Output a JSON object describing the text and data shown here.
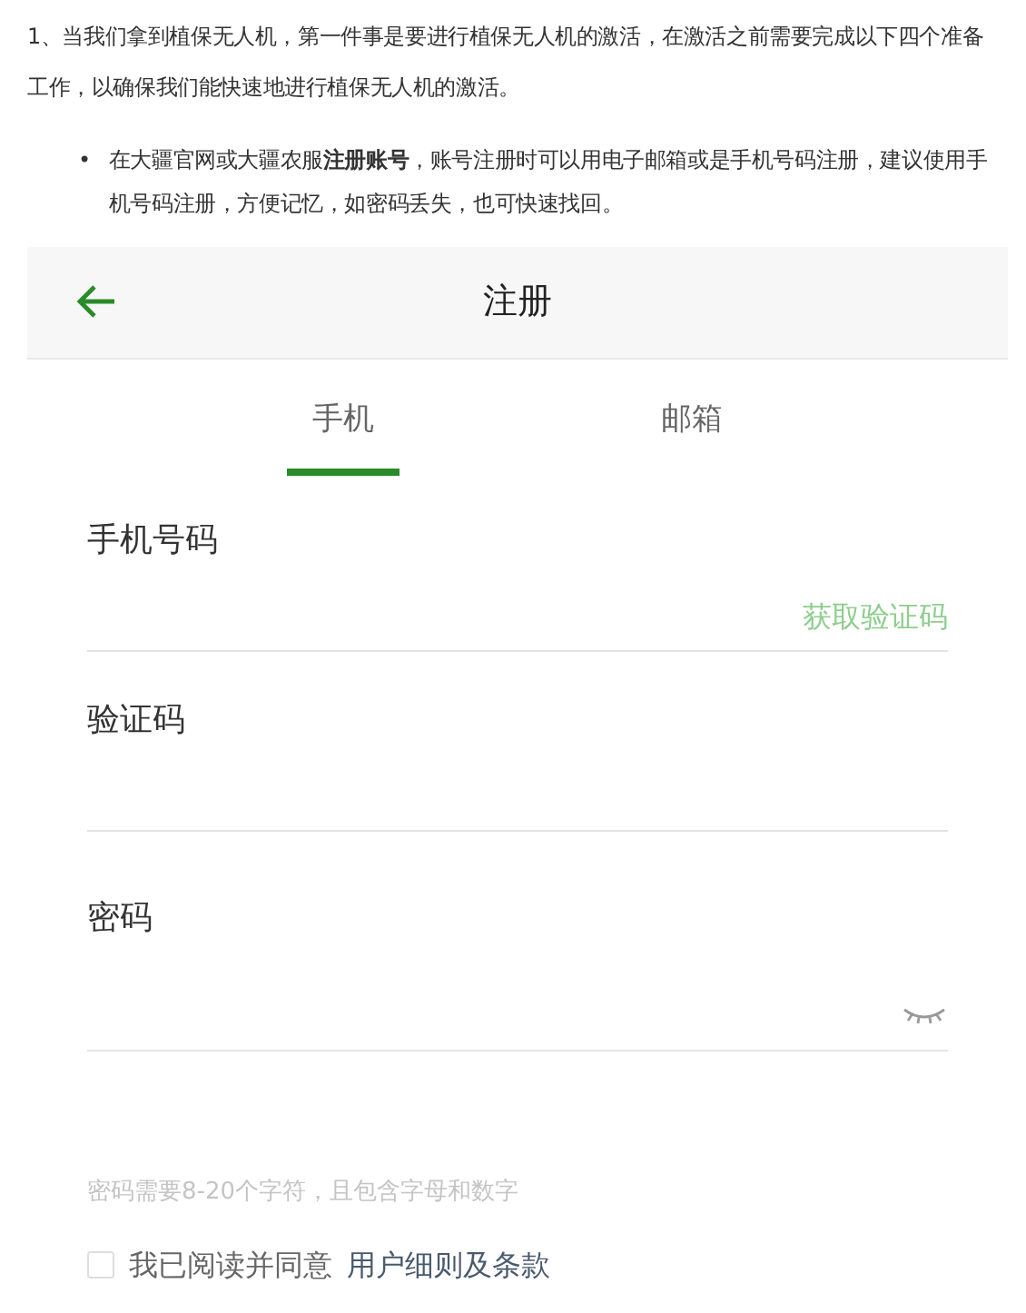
{
  "article": {
    "intro": "1、当我们拿到植保无人机，第一件事是要进行植保无人机的激活，在激活之前需要完成以下四个准备工作，以确保我们能快速地进行植保无人机的激活。",
    "bullets": [
      {
        "marker": "•",
        "text": "在大疆官网或大疆农服**注册账号**，账号注册时可以用电子邮箱或是手机号码注册，建议使用手机号码注册，方便记忆，如密码丢失，也可快速找回。"
      }
    ]
  },
  "app": {
    "title": "注册",
    "tabs": [
      {
        "label": "手机",
        "selected": true
      },
      {
        "label": "邮箱",
        "selected": false
      }
    ],
    "fields": [
      {
        "label": "手机号码",
        "kind": "code",
        "action": "获取验证码"
      },
      {
        "label": "验证码",
        "kind": "plain"
      },
      {
        "label": "密码",
        "kind": "password"
      }
    ],
    "hint": "密码需要8-20个字符，且包含字母和数字",
    "agreement": {
      "text": "我已阅读并同意",
      "link": "用户细则及条款",
      "checked": false
    }
  }
}
